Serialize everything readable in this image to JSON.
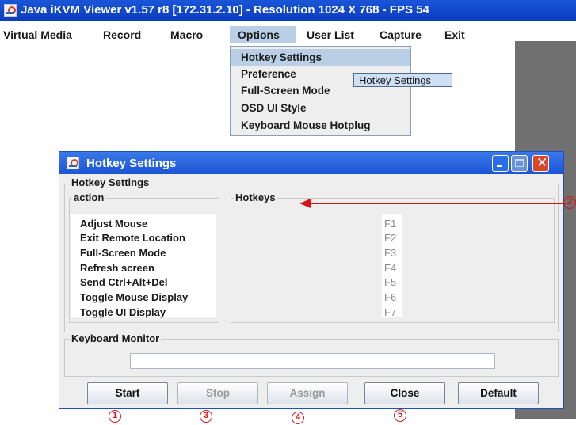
{
  "window": {
    "title": "Java iKVM Viewer v1.57 r8 [172.31.2.10]  - Resolution 1024 X 768 - FPS 54"
  },
  "menubar": [
    "Virtual Media",
    "Record",
    "Macro",
    "Options",
    "User List",
    "Capture",
    "Exit"
  ],
  "options_menu": {
    "items": [
      "Hotkey Settings",
      "Preference",
      "Full-Screen Mode",
      "OSD UI Style",
      "Keyboard Mouse Hotplug"
    ],
    "highlighted": "Hotkey Settings",
    "tooltip": "Hotkey Settings"
  },
  "dialog": {
    "title": "Hotkey Settings",
    "close_glyph": "✕",
    "group_title": "Hotkey Settings",
    "action_header": "action",
    "hotkeys_header": "Hotkeys",
    "actions": [
      "Adjust Mouse",
      "Exit Remote Location",
      "Full-Screen Mode",
      "Refresh screen",
      "Send Ctrl+Alt+Del",
      "Toggle Mouse Display",
      "Toggle UI Display"
    ],
    "hotkeys": [
      "F1",
      "F2",
      "F3",
      "F4",
      "F5",
      "F6",
      "F7"
    ],
    "keyboard_monitor_label": "Keyboard Monitor",
    "keyboard_monitor_value": "",
    "buttons": {
      "start": "Start",
      "stop": "Stop",
      "assign": "Assign",
      "close": "Close",
      "default": "Default"
    }
  },
  "annotations": [
    "1",
    "2",
    "3",
    "4",
    "5"
  ],
  "colors": {
    "title_bar": "#0a3cc0",
    "menu_highlight": "#b8cfe5",
    "annotation": "#d01818"
  }
}
